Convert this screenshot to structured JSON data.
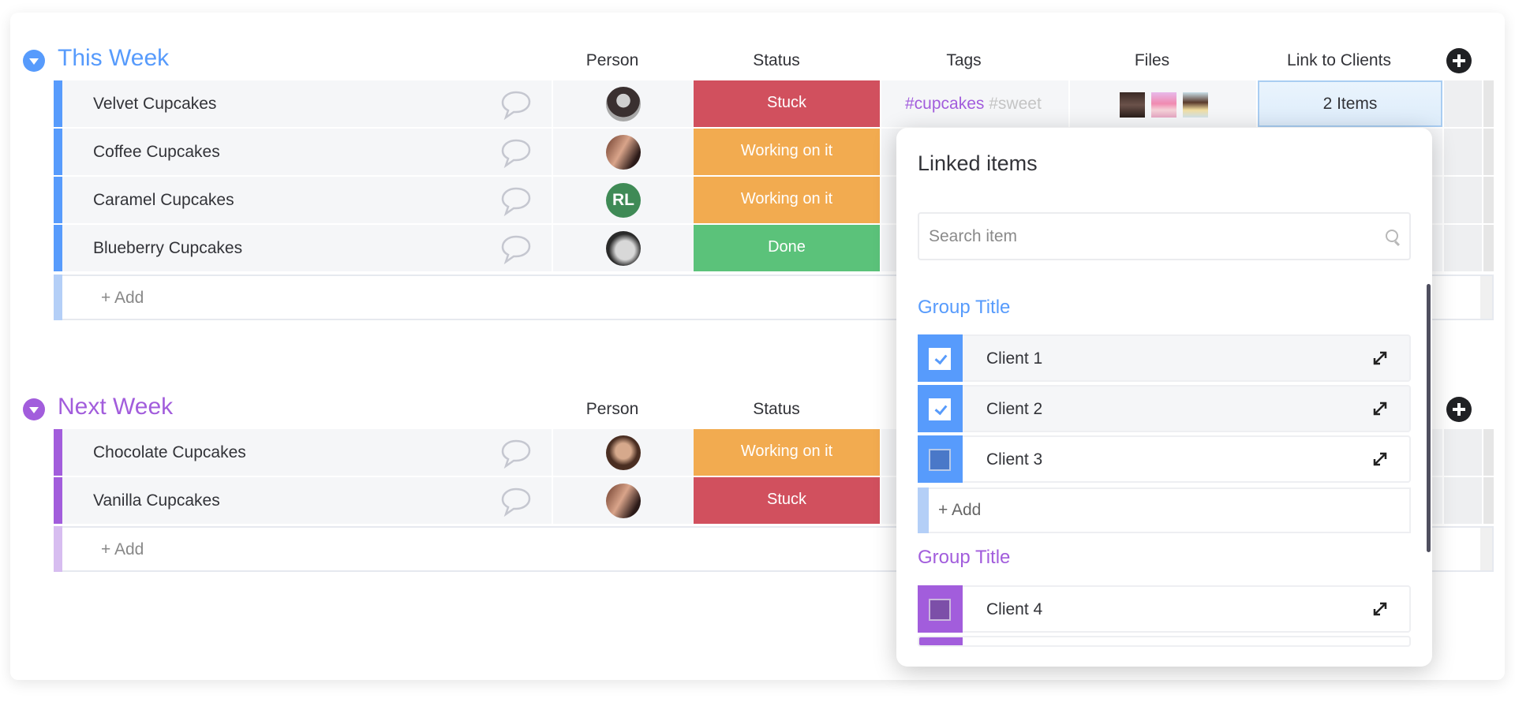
{
  "colors": {
    "this_week": "#579bfc",
    "next_week": "#a25ddc",
    "stuck": "#d1505e",
    "working": "#f2ab50",
    "done": "#5bc27a",
    "tag_purple": "#a25ddc",
    "tag_gray": "#c4c4c4"
  },
  "groups": [
    {
      "title": "This Week",
      "columns": [
        "Person",
        "Status",
        "Tags",
        "Files",
        "Link to Clients"
      ],
      "items": [
        {
          "name": "Velvet Cupcakes",
          "person": "photo",
          "status": "Stuck",
          "tags": [
            "#cupcakes",
            "#sweet"
          ],
          "files": [
            "chocolate-cupcake",
            "pink-cupcake",
            "vanilla-cupcake"
          ],
          "link": "2 Items"
        },
        {
          "name": "Coffee Cupcakes",
          "person": "photo",
          "status": "Working on it"
        },
        {
          "name": "Caramel Cupcakes",
          "person": "RL",
          "status": "Working on it"
        },
        {
          "name": "Blueberry Cupcakes",
          "person": "photo",
          "status": "Done"
        }
      ],
      "add_label": "+ Add"
    },
    {
      "title": "Next Week",
      "columns": [
        "Person",
        "Status"
      ],
      "items": [
        {
          "name": "Chocolate Cupcakes",
          "person": "photo",
          "status": "Working on it",
          "tags_partial": "#"
        },
        {
          "name": "Vanilla Cupcakes",
          "person": "photo",
          "status": "Stuck",
          "tags_partial": "#"
        }
      ],
      "add_label": "+ Add"
    }
  ],
  "popup": {
    "title": "Linked items",
    "search_placeholder": "Search item",
    "groups": [
      {
        "title": "Group Title",
        "items": [
          {
            "label": "Client 1",
            "checked": true
          },
          {
            "label": "Client 2",
            "checked": true
          },
          {
            "label": "Client 3",
            "checked": false
          }
        ],
        "add_label": "+ Add"
      },
      {
        "title": "Group Title",
        "items": [
          {
            "label": "Client 4",
            "checked": false
          }
        ]
      }
    ]
  }
}
